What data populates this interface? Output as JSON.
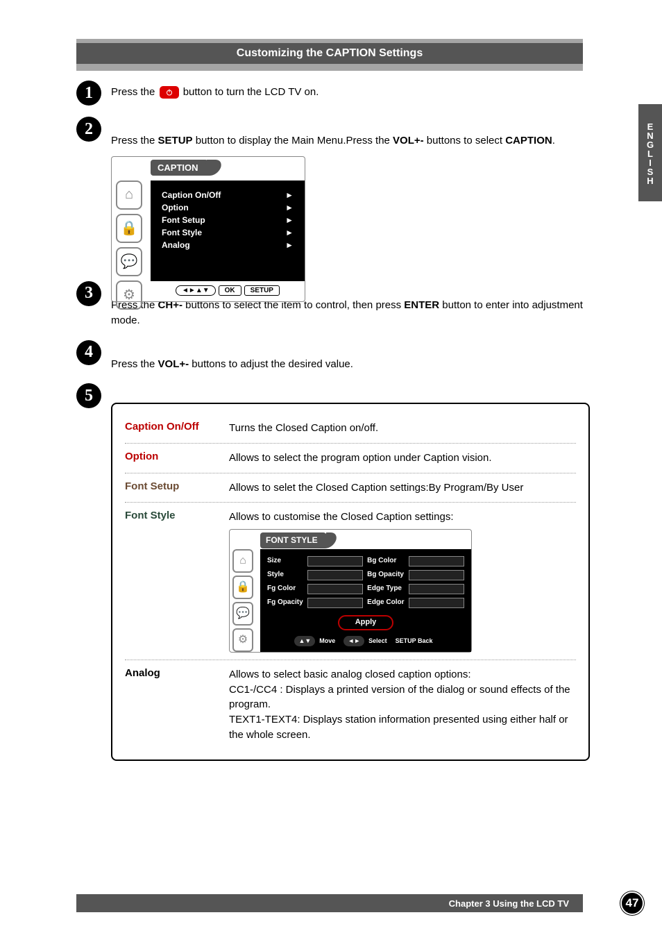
{
  "header": {
    "title": "Customizing the CAPTION Settings"
  },
  "side_tab": "ENGLISH",
  "steps": {
    "s1": {
      "pre": "Press the ",
      "post": " button to turn the LCD TV on."
    },
    "s2": {
      "pre": "Press the ",
      "setup": "SETUP",
      "mid": " button to display the Main Menu.Press the ",
      "vol": "VOL+-",
      "mid2": " buttons to select ",
      "caption": "CAPTION",
      "end": "."
    },
    "s3": {
      "pre": "Press the ",
      "ch": "CH+-",
      "mid": " buttons to select the item to control, then press ",
      "enter": "ENTER",
      "post": " button to enter into adjustment mode."
    },
    "s4": {
      "pre": "Press the ",
      "vol": "VOL+-",
      "post": " buttons to adjust the desired value."
    }
  },
  "osd": {
    "title": "CAPTION",
    "items": [
      {
        "label": "Caption On/Off"
      },
      {
        "label": "Option"
      },
      {
        "label": "Font Setup"
      },
      {
        "label": "Font Style"
      },
      {
        "label": "Analog"
      }
    ],
    "keys": {
      "nav": "◄►▲▼",
      "ok": "OK",
      "setup": "SETUP"
    }
  },
  "table": {
    "rows": [
      {
        "label": "Caption On/Off",
        "cls": "red",
        "desc_intro": "Turns the Closed Caption on/off."
      },
      {
        "label": "Option",
        "cls": "red",
        "desc_intro": "Allows to select the program option under Caption vision."
      },
      {
        "label": "Font Setup",
        "cls": "brown",
        "desc_intro": "Allows to selet the Closed Caption settings:By Program/By User"
      },
      {
        "label": "Font Style",
        "cls": "green",
        "desc_intro": "Allows to customise the Closed Caption settings:"
      },
      {
        "label": "Analog",
        "cls": "",
        "desc_intro": " Allows to select basic analog closed caption options:\nCC1-/CC4 : Displays a printed version of the dialog or sound effects of the program.\nTEXT1-TEXT4: Displays station information presented using either half or the whole screen."
      }
    ]
  },
  "fontstyle": {
    "title": "FONT STYLE",
    "left": [
      "Size",
      "Style",
      "Fg Color",
      "Fg Opacity"
    ],
    "right": [
      "Bg Color",
      "Bg Opacity",
      "Edge Type",
      "Edge Color"
    ],
    "apply": "Apply",
    "footer": {
      "k1": "▲▼",
      "t1": "Move",
      "k2": "◄►",
      "t2": "Select",
      "t3": "SETUP  Back"
    }
  },
  "footer": {
    "chapter": "Chapter 3 Using the LCD TV",
    "page": "47"
  }
}
